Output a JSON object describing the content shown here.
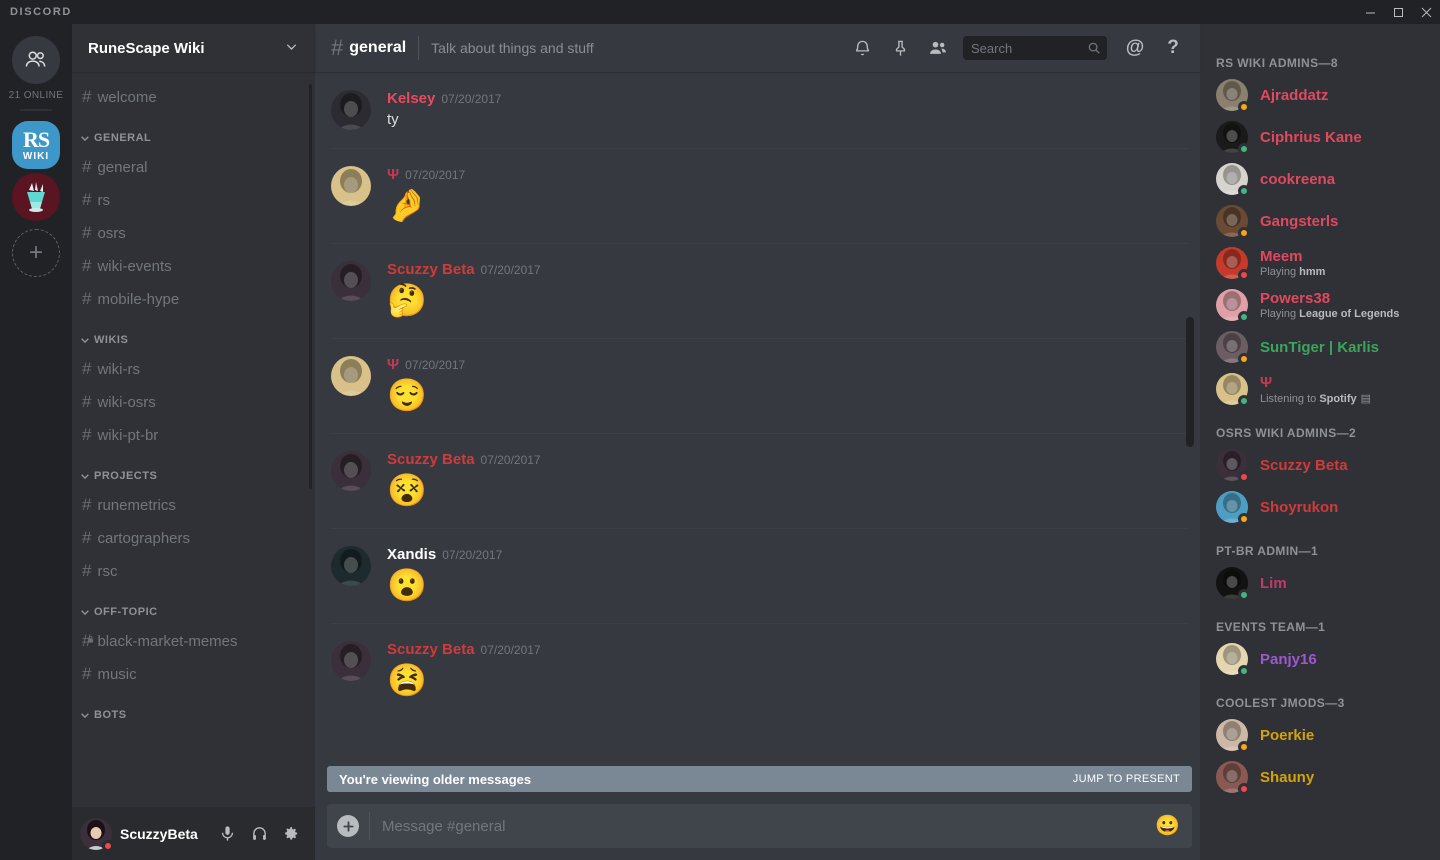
{
  "window": {
    "brand": "DISCORD",
    "minimize_label": "Minimize",
    "maximize_label": "Maximize",
    "close_label": "Close"
  },
  "rail": {
    "dm_label": "Direct Messages",
    "online_count": "21 ONLINE",
    "servers": [
      {
        "name": "RuneScape Wiki",
        "line1": "RS",
        "line2": "WIKI",
        "active": true
      },
      {
        "name": "OSRS Server",
        "line1": "",
        "line2": "",
        "active": false
      }
    ],
    "add_server_label": "+"
  },
  "sidebar": {
    "guild_name": "RuneScape Wiki",
    "chevron": "chevron-down-icon",
    "top_channels": [
      {
        "name": "welcome",
        "locked": false
      }
    ],
    "categories": [
      {
        "label": "GENERAL",
        "channels": [
          {
            "name": "general",
            "locked": false,
            "active": false
          },
          {
            "name": "rs",
            "locked": false,
            "active": false
          },
          {
            "name": "osrs",
            "locked": false,
            "active": false
          },
          {
            "name": "wiki-events",
            "locked": false,
            "active": false
          },
          {
            "name": "mobile-hype",
            "locked": false,
            "active": false
          }
        ]
      },
      {
        "label": "WIKIS",
        "channels": [
          {
            "name": "wiki-rs",
            "locked": false,
            "active": false
          },
          {
            "name": "wiki-osrs",
            "locked": false,
            "active": false
          },
          {
            "name": "wiki-pt-br",
            "locked": false,
            "active": false
          }
        ]
      },
      {
        "label": "PROJECTS",
        "channels": [
          {
            "name": "runemetrics",
            "locked": false,
            "active": false
          },
          {
            "name": "cartographers",
            "locked": false,
            "active": false
          },
          {
            "name": "rsc",
            "locked": false,
            "active": false
          }
        ]
      },
      {
        "label": "OFF-TOPIC",
        "channels": [
          {
            "name": "black-market-memes",
            "locked": true,
            "active": false
          },
          {
            "name": "music",
            "locked": false,
            "active": false
          }
        ]
      },
      {
        "label": "BOTS",
        "channels": []
      }
    ],
    "user_panel": {
      "username": "ScuzzyBeta",
      "status": "dnd",
      "status_color": "#f04747",
      "mic_label": "Mute",
      "headphones_label": "Deafen",
      "settings_label": "User Settings"
    }
  },
  "channel_header": {
    "hash": "#",
    "name": "general",
    "topic": "Talk about things and stuff",
    "actions": [
      {
        "icon": "bell-icon",
        "label": "Notification Settings"
      },
      {
        "icon": "pin-icon",
        "label": "Pinned Messages"
      },
      {
        "icon": "members-icon",
        "label": "Member List"
      }
    ],
    "search": {
      "placeholder": "Search",
      "value": "",
      "icon": "search-icon"
    },
    "mentions_label": "@",
    "help_label": "?"
  },
  "messages": [
    {
      "author": "Kelsey",
      "color": "#e84a5f",
      "time": "07/20/2017",
      "text": "ty",
      "emoji": "",
      "avatar_bg": "#2b2b31"
    },
    {
      "author": "Ψ",
      "color": "#c43a54",
      "time": "07/20/2017",
      "text": "",
      "emoji": "🤌",
      "avatar_bg": "#d9c28a"
    },
    {
      "author": "Scuzzy Beta",
      "color": "#cf3b3b",
      "time": "07/20/2017",
      "text": "",
      "emoji": "🤔",
      "avatar_bg": "#3a2f3a"
    },
    {
      "author": "Ψ",
      "color": "#c43a54",
      "time": "07/20/2017",
      "text": "",
      "emoji": "😌",
      "avatar_bg": "#d9c28a"
    },
    {
      "author": "Scuzzy Beta",
      "color": "#cf3b3b",
      "time": "07/20/2017",
      "text": "",
      "emoji": "😵",
      "avatar_bg": "#3a2f3a"
    },
    {
      "author": "Xandis",
      "color": "#ffffff",
      "time": "07/20/2017",
      "text": "",
      "emoji": "😮",
      "avatar_bg": "#1d2a2e"
    },
    {
      "author": "Scuzzy Beta",
      "color": "#cf3b3b",
      "time": "07/20/2017",
      "text": "",
      "emoji": "😫",
      "avatar_bg": "#3a2f3a"
    }
  ],
  "older_bar": {
    "text": "You're viewing older messages",
    "jump_label": "JUMP TO PRESENT"
  },
  "composer": {
    "placeholder": "Message #general",
    "plus_label": "+",
    "emoji_icon": "😀"
  },
  "member_groups": [
    {
      "label": "RS WIKI ADMINS—8",
      "members": [
        {
          "name": "Ajraddatz",
          "color": "#e0495f",
          "status": "idle",
          "status_color": "#faa61a",
          "activity": "",
          "activity_bold": "",
          "avatar_bg": "#8b7f6d"
        },
        {
          "name": "Ciphrius Kane",
          "color": "#e0495f",
          "status": "online",
          "status_color": "#43b581",
          "activity": "",
          "activity_bold": "",
          "avatar_bg": "#1a1a1a"
        },
        {
          "name": "cookreena",
          "color": "#e0495f",
          "status": "online",
          "status_color": "#43b581",
          "activity": "",
          "activity_bold": "",
          "avatar_bg": "#d7d4cd"
        },
        {
          "name": "Gangsterls",
          "color": "#e0495f",
          "status": "idle",
          "status_color": "#faa61a",
          "activity": "",
          "activity_bold": "",
          "avatar_bg": "#6b4a33"
        },
        {
          "name": "Meem",
          "color": "#e0495f",
          "status": "dnd",
          "status_color": "#f04747",
          "activity": "Playing ",
          "activity_bold": "hmm",
          "avatar_bg": "#c63a2c"
        },
        {
          "name": "Powers38",
          "color": "#e0495f",
          "status": "online",
          "status_color": "#43b581",
          "activity": "Playing ",
          "activity_bold": "League of Legends",
          "avatar_bg": "#e0a0a8"
        },
        {
          "name": "SunTiger | Karlis",
          "color": "#3ba55c",
          "status": "idle",
          "status_color": "#faa61a",
          "activity": "",
          "activity_bold": "",
          "avatar_bg": "#6c5d63"
        },
        {
          "name": "Ψ",
          "color": "#c43a54",
          "status": "online",
          "status_color": "#43b581",
          "activity": "Listening to ",
          "activity_bold": "Spotify",
          "avatar_bg": "#d9c28a"
        }
      ]
    },
    {
      "label": "OSRS WIKI ADMINS—2",
      "members": [
        {
          "name": "Scuzzy Beta",
          "color": "#cf3b3b",
          "status": "dnd",
          "status_color": "#f04747",
          "activity": "",
          "activity_bold": "",
          "avatar_bg": "#3a2f3a"
        },
        {
          "name": "Shoyrukon",
          "color": "#cf3b3b",
          "status": "idle",
          "status_color": "#faa61a",
          "activity": "",
          "activity_bold": "",
          "avatar_bg": "#4e9ec4"
        }
      ]
    },
    {
      "label": "PT-BR ADMIN—1",
      "members": [
        {
          "name": "Lim",
          "color": "#c23b68",
          "status": "online",
          "status_color": "#43b581",
          "activity": "",
          "activity_bold": "",
          "avatar_bg": "#121212"
        }
      ]
    },
    {
      "label": "EVENTS TEAM—1",
      "members": [
        {
          "name": "Panjy16",
          "color": "#9b59d0",
          "status": "online",
          "status_color": "#43b581",
          "activity": "",
          "activity_bold": "",
          "avatar_bg": "#e3d6b0"
        }
      ]
    },
    {
      "label": "COOLEST JMODS—3",
      "members": [
        {
          "name": "Poerkie",
          "color": "#d2a30a",
          "status": "idle",
          "status_color": "#faa61a",
          "activity": "",
          "activity_bold": "",
          "avatar_bg": "#cdb8a5"
        },
        {
          "name": "Shauny",
          "color": "#d2a30a",
          "status": "dnd",
          "status_color": "#f04747",
          "activity": "",
          "activity_bold": "",
          "avatar_bg": "#8a5a52"
        }
      ]
    }
  ]
}
